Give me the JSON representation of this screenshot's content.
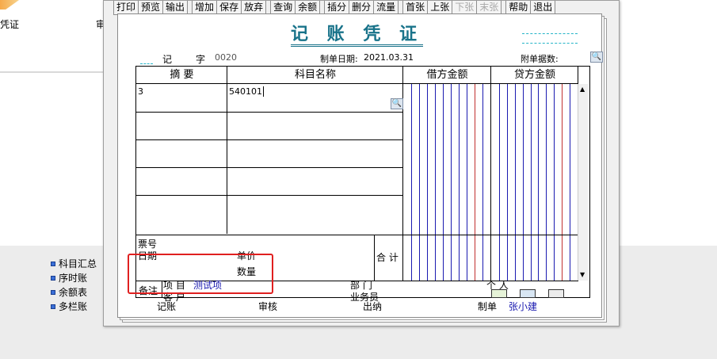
{
  "background": {
    "left_label": "凭证",
    "mid_label": "审",
    "side_menu": [
      "科目汇总",
      "序时账",
      "余额表",
      "多栏账"
    ]
  },
  "toolbar": {
    "groups": [
      [
        "打印",
        "预览",
        "输出"
      ],
      [
        "增加",
        "保存",
        "放弃"
      ],
      [
        "查询",
        "余额"
      ],
      [
        "插分",
        "删分",
        "流量"
      ],
      [
        "首张",
        "上张",
        "下张",
        "末张"
      ],
      [
        "帮助",
        "退出"
      ]
    ],
    "disabled": [
      "下张",
      "末张"
    ]
  },
  "voucher": {
    "title": "记 账 凭 证",
    "type_label": "记",
    "no_label": "字",
    "no_value": "0020",
    "date_label": "制单日期:",
    "date_value": "2021.03.31",
    "attach_label": "附单据数:",
    "columns": {
      "summary": "摘 要",
      "account": "科目名称",
      "debit": "借方金额",
      "credit": "贷方金额"
    },
    "row1": {
      "summary": "3",
      "account": "540101"
    },
    "bottom": {
      "ticket_no": "票号",
      "date": "日期",
      "unit_price": "单价",
      "quantity": "数量",
      "total": "合 计",
      "remark": "备注",
      "project_label": "项 目",
      "project_value": "测试项",
      "customer_label": "客 户",
      "dept_label": "部 门",
      "person_label": "个 人",
      "salesman_label": "业务员"
    },
    "footer": {
      "bookkeeping": "记账",
      "audit": "审核",
      "cashier": "出纳",
      "maker_label": "制单",
      "maker_value": "张小建"
    }
  },
  "colors": {
    "title": "#19738a",
    "highlight_box": "#e02020",
    "debit_line": "#1a1ab0",
    "credit_line": "#c03030"
  }
}
